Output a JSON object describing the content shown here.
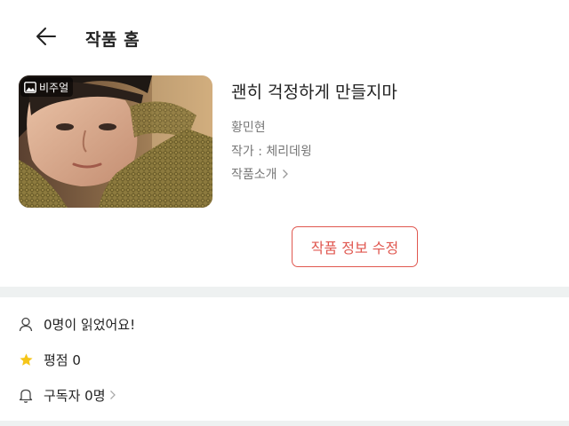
{
  "header": {
    "title": "작품 홈"
  },
  "work": {
    "cover_badge": "비주얼",
    "title": "괜히 걱정하게 만들지마",
    "subtitle": "황민현",
    "author": "작가 : 체리데윙",
    "intro_link": "작품소개"
  },
  "actions": {
    "edit_label": "작품 정보 수정"
  },
  "stats": {
    "readers": "0명이 읽었어요!",
    "rating": "평점 0",
    "subscribers": "구독자 0명"
  },
  "colors": {
    "accent": "#e0574f",
    "star": "#f5c518",
    "divider": "#eef1f1"
  }
}
